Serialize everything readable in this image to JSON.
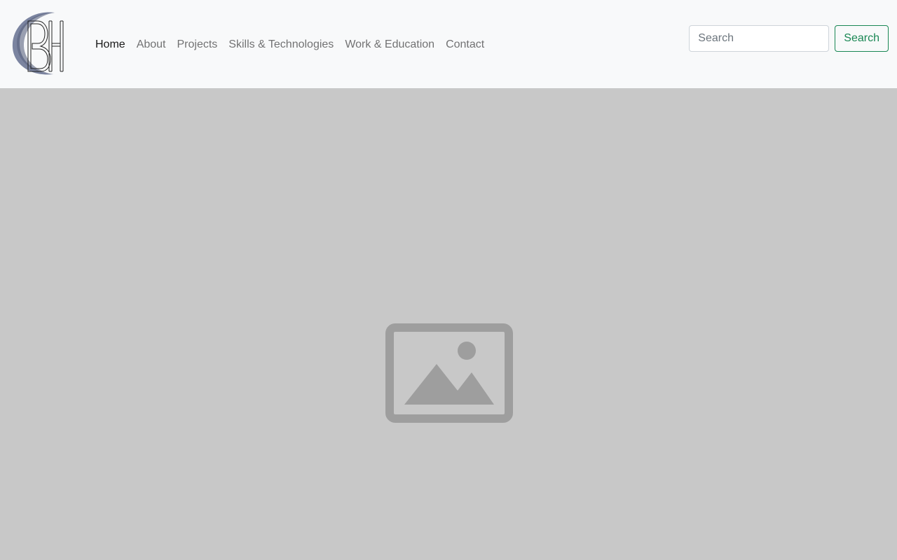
{
  "brand": {
    "logo_text": "BH",
    "icon": "bh-logo"
  },
  "nav": {
    "items": [
      {
        "label": "Home",
        "active": true
      },
      {
        "label": "About",
        "active": false
      },
      {
        "label": "Projects",
        "active": false
      },
      {
        "label": "Skills & Technologies",
        "active": false
      },
      {
        "label": "Work & Education",
        "active": false
      },
      {
        "label": "Contact",
        "active": false
      }
    ]
  },
  "search": {
    "placeholder": "Search",
    "value": "",
    "button_label": "Search"
  },
  "hero": {
    "icon": "image-placeholder-icon"
  },
  "colors": {
    "navbar_bg": "#f8f9fa",
    "hero_bg": "#c8c8c8",
    "placeholder_icon": "#9e9e9e",
    "search_button_accent": "#198754",
    "logo_crescent": "#7b84a0"
  }
}
